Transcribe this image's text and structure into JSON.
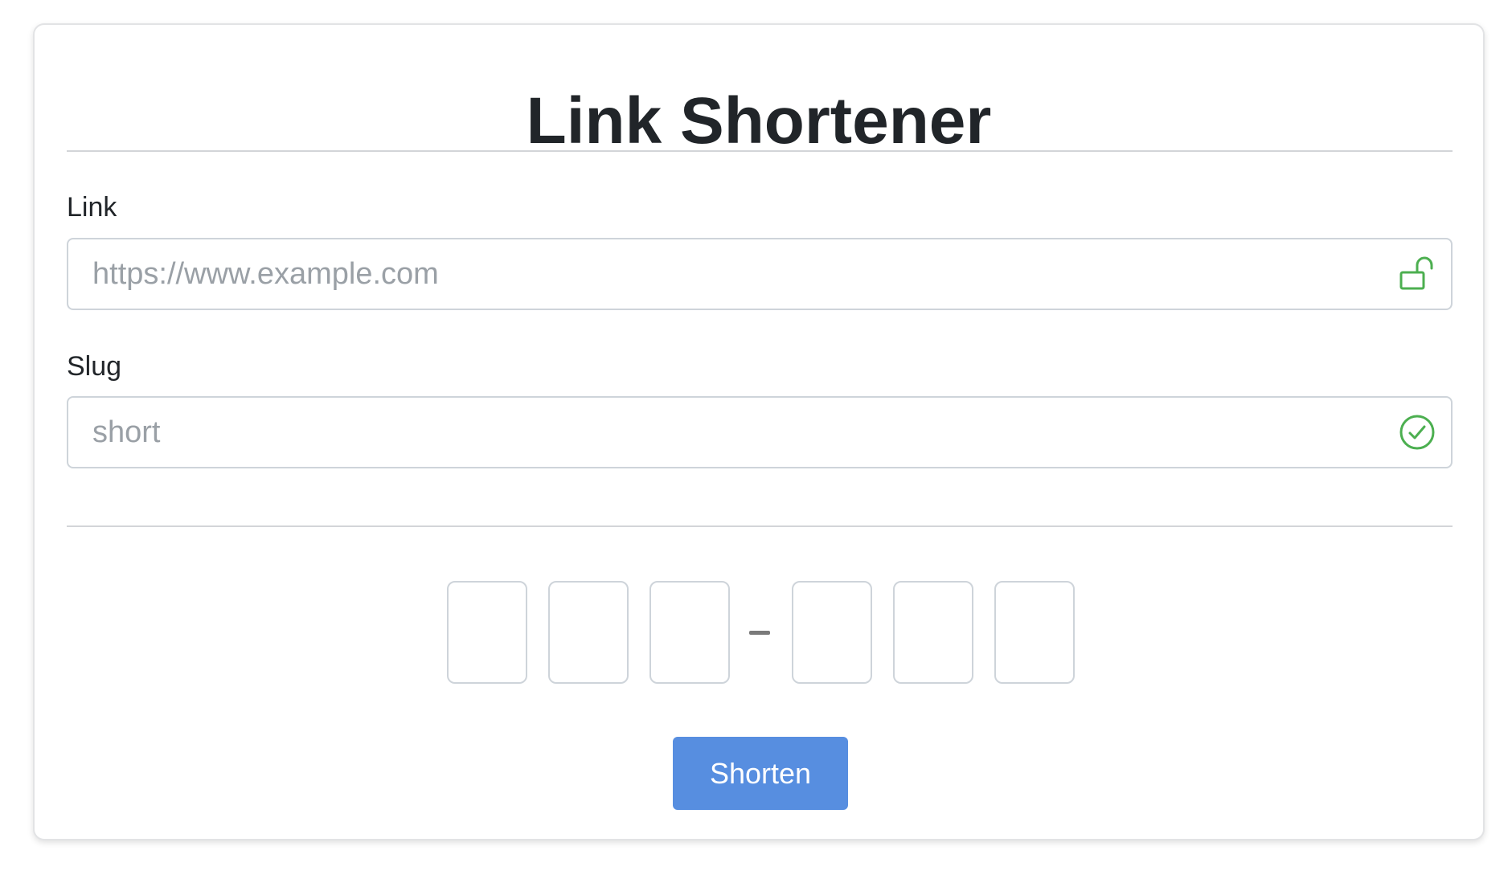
{
  "page": {
    "title": "Link Shortener"
  },
  "form": {
    "link": {
      "label": "Link",
      "placeholder": "https://www.example.com",
      "value": "",
      "icon": "unlocked-padlock-icon",
      "icon_color": "#4caf50"
    },
    "slug": {
      "label": "Slug",
      "placeholder": "short",
      "value": "",
      "icon": "check-circle-icon",
      "icon_color": "#4caf50"
    },
    "code": {
      "digits": [
        "",
        "",
        "",
        "",
        "",
        ""
      ],
      "separator": "-"
    },
    "submit_label": "Shorten",
    "accent_color": "#578ee0"
  }
}
